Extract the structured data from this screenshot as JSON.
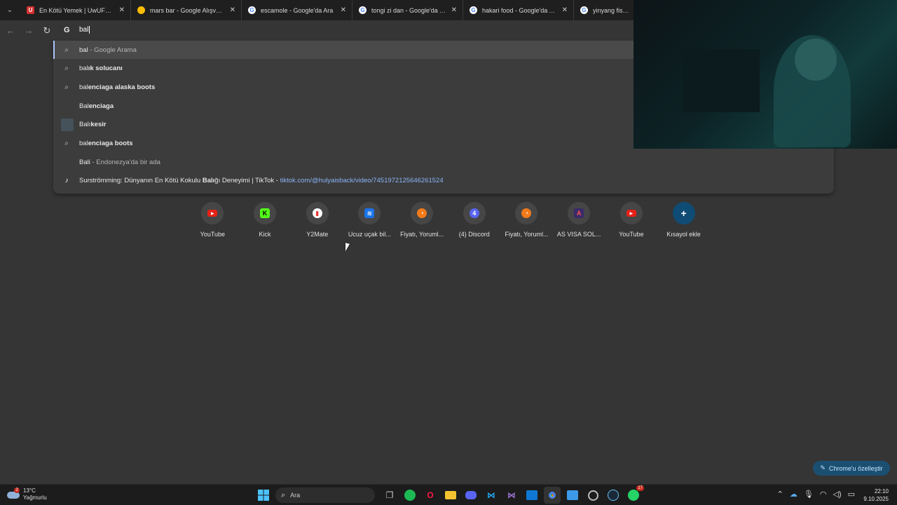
{
  "tabs": [
    {
      "title": "En Kötü Yemek | UwUFUFU",
      "fav_color": "#d32f2f",
      "fav_letter": "U"
    },
    {
      "title": "mars bar - Google Alışveriş",
      "fav_color": "#fbbc04",
      "fav_letter": ""
    },
    {
      "title": "escamole - Google'da Ara",
      "fav_color": "#ffffff",
      "fav_letter": "G"
    },
    {
      "title": "tongi zi dan - Google'da Ara",
      "fav_color": "#ffffff",
      "fav_letter": "G"
    },
    {
      "title": "hakari food - Google'da Ara",
      "fav_color": "#ffffff",
      "fav_letter": "G"
    },
    {
      "title": "yinyang fish - Goo",
      "fav_color": "#ffffff",
      "fav_letter": "G"
    }
  ],
  "omnibox": {
    "typed": "bal",
    "engine_icon": "G"
  },
  "suggestions": [
    {
      "icon": "search",
      "typed": "bal",
      "bold": "",
      "suffix": " - Google Arama"
    },
    {
      "icon": "search",
      "typed": "bal",
      "bold": "ık solucanı",
      "suffix": ""
    },
    {
      "icon": "search",
      "typed": "bal",
      "bold": "enciaga alaska boots",
      "suffix": ""
    },
    {
      "icon": "none",
      "typed": "Bal",
      "bold": "enciaga",
      "suffix": ""
    },
    {
      "icon": "image",
      "typed": "Balı",
      "bold": "kesir",
      "suffix": ""
    },
    {
      "icon": "search",
      "typed": "bal",
      "bold": "enciaga boots",
      "suffix": ""
    },
    {
      "icon": "none",
      "typed": "Bali",
      "bold": "",
      "suffix": " - Endonezya'da bir ada"
    },
    {
      "icon": "tiktok",
      "text_a": "Surströmming: Dünyanın En Kötü Kokulu ",
      "text_b": "Balı",
      "text_c": "ğı Deneyimi | TikTok - ",
      "url": "tiktok.com/@hulyaisback/video/7451972125646261524"
    }
  ],
  "shortcuts": [
    {
      "label": "YouTube",
      "icon": "youtube-icon",
      "color": "#e62117",
      "glyph": "▶"
    },
    {
      "label": "Kick",
      "icon": "kick-icon",
      "color": "#53fc18",
      "glyph": "K"
    },
    {
      "label": "Y2Mate",
      "icon": "y2mate-icon",
      "color": "#ffffff",
      "glyph": "▮"
    },
    {
      "label": "Ucuz uçak bil...",
      "icon": "plane-ticket-icon",
      "color": "#1a73e8",
      "glyph": "≋"
    },
    {
      "label": "Fiyatı, Yoruml...",
      "icon": "shop-icon",
      "color": "#f27a1a",
      "glyph": "◔"
    },
    {
      "label": "(4) Discord",
      "icon": "discord-icon",
      "color": "#5865f2",
      "glyph": "4"
    },
    {
      "label": "Fiyatı, Yoruml...",
      "icon": "shop-icon",
      "color": "#f27a1a",
      "glyph": "◔"
    },
    {
      "label": "AS VISA SOL...",
      "icon": "visa-icon",
      "color": "#3a2a6a",
      "glyph": "A"
    },
    {
      "label": "YouTube",
      "icon": "youtube-icon",
      "color": "#e62117",
      "glyph": "▶"
    },
    {
      "label": "Kısayol ekle",
      "icon": "plus-icon",
      "color": "#0f4c75",
      "glyph": "+"
    }
  ],
  "customize_label": "Chrome'u özelleştir",
  "taskbar": {
    "weather_temp": "13°C",
    "weather_desc": "Yağmurlu",
    "weather_badge": "2",
    "search_placeholder": "Ara",
    "time": "22:10",
    "date": "9.10.2025",
    "whatsapp_badge": "17"
  }
}
